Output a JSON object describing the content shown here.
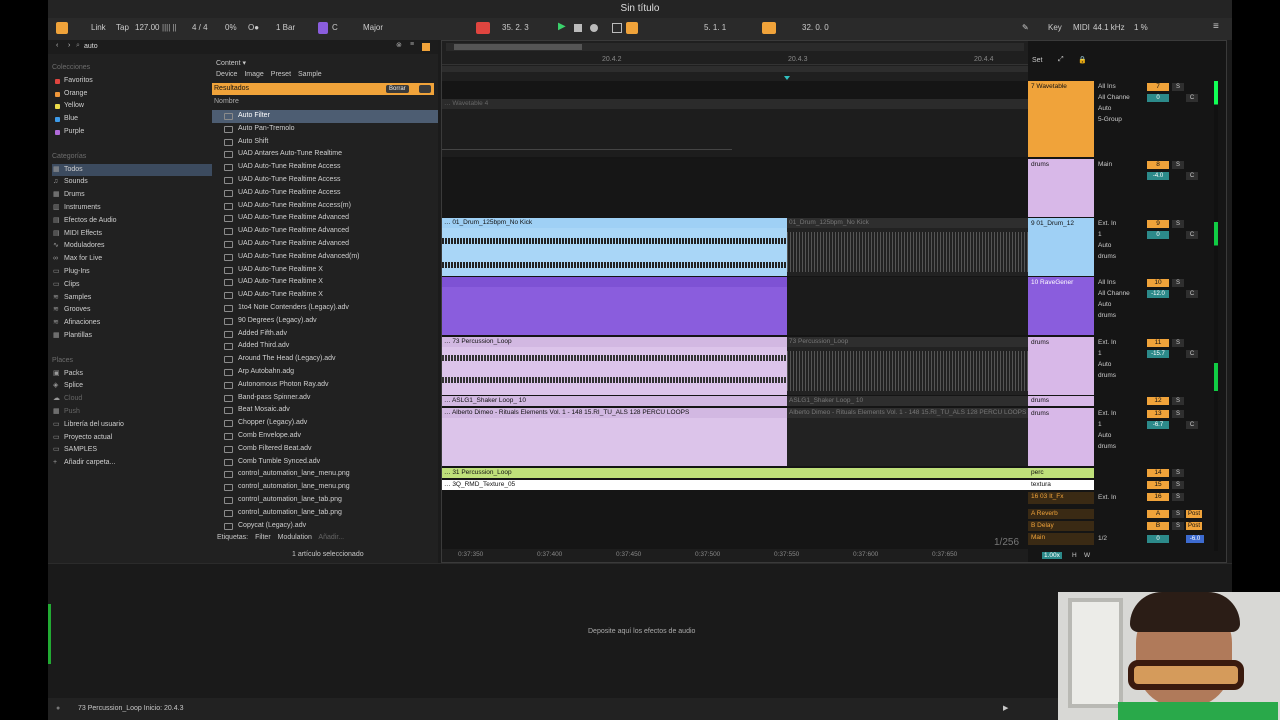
{
  "window": {
    "title": "Sin título"
  },
  "control": {
    "link": "Link",
    "tap": "Tap",
    "tempo": "127.00",
    "sig": "4 / 4",
    "swing": "0%",
    "quant": "1 Bar",
    "key": "C",
    "scale": "Major",
    "pos": "35.   2.   3",
    "loop_start": "5.   1.   1",
    "loop_len": "32.   0.   0",
    "key_btn": "Key",
    "midi_btn": "MIDI",
    "sample_rate": "44.1 kHz",
    "cpu": "1 %"
  },
  "browser": {
    "search": "auto",
    "collections_header": "Colecciones",
    "collections": [
      {
        "label": "Favoritos",
        "color": "#e0453f"
      },
      {
        "label": "Orange",
        "color": "#f0973a"
      },
      {
        "label": "Yellow",
        "color": "#eddc4a"
      },
      {
        "label": "Blue",
        "color": "#3d9be9"
      },
      {
        "label": "Purple",
        "color": "#b06ad9"
      }
    ],
    "categories_header": "Categorías",
    "categories": [
      "Todos",
      "Sounds",
      "Drums",
      "Instruments",
      "Efectos de Audio",
      "MIDI Effects",
      "Moduladores",
      "Max for Live",
      "Plug-Ins",
      "Clips",
      "Samples",
      "Grooves",
      "Afinaciones",
      "Plantillas"
    ],
    "places_header": "Places",
    "places": [
      "Packs",
      "Splice",
      "Cloud",
      "Push",
      "Librería del usuario",
      "Proyecto actual",
      "SAMPLES",
      "Añadir carpeta..."
    ],
    "content_label": "Content",
    "filters": [
      "Device",
      "Image",
      "Preset",
      "Sample"
    ],
    "results_label": "Resultados",
    "clear_label": "Borrar",
    "name_col": "Nombre",
    "files": [
      "Auto Filter",
      "Auto Pan-Tremolo",
      "Auto Shift",
      "UAD Antares Auto-Tune Realtime",
      "UAD Auto-Tune Realtime Access",
      "UAD Auto-Tune Realtime Access",
      "UAD Auto-Tune Realtime Access",
      "UAD Auto-Tune Realtime Access(m)",
      "UAD Auto-Tune Realtime Advanced",
      "UAD Auto-Tune Realtime Advanced",
      "UAD Auto-Tune Realtime Advanced",
      "UAD Auto-Tune Realtime Advanced(m)",
      "UAD Auto-Tune Realtime X",
      "UAD Auto-Tune Realtime X",
      "UAD Auto-Tune Realtime X",
      "1to4 Note Contenders (Legacy).adv",
      "90 Degrees (Legacy).adv",
      "Added Fifth.adv",
      "Added Third.adv",
      "Around The Head (Legacy).adv",
      "Arp Autobahn.adg",
      "Autonomous Photon Ray.adv",
      "Band-pass Spinner.adv",
      "Beat Mosaic.adv",
      "Chopper (Legacy).adv",
      "Comb Envelope.adv",
      "Comb Filtered Beat.adv",
      "Comb Tumble Synced.adv",
      "control_automation_lane_menu.png",
      "control_automation_lane_menu.png",
      "control_automation_lane_tab.png",
      "control_automation_lane_tab.png",
      "Copycat (Legacy).adv"
    ],
    "tags_label": "Etiquetas:",
    "tag_filter": "Filter",
    "tag_mod": "Modulation",
    "tag_add": "Añadir...",
    "selected_info": "1 artículo seleccionado"
  },
  "arrangement": {
    "ruler_marks": [
      "20.4.2",
      "20.4.3",
      "20.4.4"
    ],
    "time_marks": [
      "0:37:350",
      "0:37:400",
      "0:37:450",
      "0:37:500",
      "0:37:550",
      "0:37:600",
      "0:37:650"
    ],
    "zoom": "1/256",
    "clips": {
      "wavetable": "Wavetable 4",
      "drum_a": "01_Drum_125bpm_No Kick",
      "drum_b": "01_Drum_125bpm_No Kick",
      "perc_a": "73 Percussion_Loop",
      "perc_b": "73 Percussion_Loop",
      "shaker_a": "ASLG1_Shaker Loop_ 10",
      "shaker_b": "ASLG1_Shaker Loop_ 10",
      "alberto_a": "Alberto Dimeo - Rituals Elements Vol. 1 - 148 15.RI_TU_ALS 128 PERCU LOOPS",
      "alberto_b": "Alberto Dimeo - Rituals Elements Vol. 1 - 148 15.RI_TU_ALS 128 PERCU LOOPS",
      "perc31": "31 Percussion_Loop",
      "texture": "3Q_RMD_Texture_05"
    }
  },
  "mixer": {
    "set_label": "Set",
    "tracks": [
      {
        "name": "7 Wavetable",
        "color": "#f0a33a",
        "in": "All Ins",
        "ch": "All Channe",
        "mon": "Auto",
        "out": "5-Group",
        "num": "7",
        "vol": "0",
        "pan": "C"
      },
      {
        "name": "drums",
        "color": "#d8b8e8",
        "in": "Main",
        "ch": "",
        "mon": "",
        "out": "",
        "num": "8",
        "vol": "-4.0",
        "pan": "C"
      },
      {
        "name": "9 01_Drum_12",
        "color": "#9fd0f5",
        "in": "Ext. In",
        "ch": "1",
        "mon": "Auto",
        "out": "drums",
        "num": "9",
        "vol": "0",
        "pan": "C"
      },
      {
        "name": "10 RaveGener",
        "color": "#8a5ddd",
        "in": "All Ins",
        "ch": "All Channe",
        "mon": "Auto",
        "out": "drums",
        "num": "10",
        "vol": "-12.0",
        "pan": "C"
      },
      {
        "name": "drums",
        "color": "#d8b8e8",
        "in": "Ext. In",
        "ch": "1",
        "mon": "Auto",
        "out": "drums",
        "num": "11",
        "vol": "-15.7",
        "pan": "C"
      },
      {
        "name": "drums",
        "color": "#d8b8e8",
        "in": "",
        "ch": "",
        "mon": "",
        "out": "",
        "num": "12",
        "vol": "",
        "pan": ""
      },
      {
        "name": "drums",
        "color": "#d8b8e8",
        "in": "Ext. In",
        "ch": "1",
        "mon": "Auto",
        "out": "drums",
        "num": "13",
        "vol": "-6.7",
        "pan": "C"
      },
      {
        "name": "perc",
        "color": "#bfe07a",
        "num": "14"
      },
      {
        "name": "textura",
        "color": "#ffffff",
        "num": "15"
      },
      {
        "name": "16 03 It_Fx",
        "color": "#f0a33a",
        "in": "Ext. In",
        "num": "16"
      },
      {
        "name": "A Reverb",
        "color": "#f0a33a",
        "num": "A",
        "post": "Post"
      },
      {
        "name": "B Delay",
        "color": "#f0a33a",
        "num": "B",
        "post": "Post"
      },
      {
        "name": "Main",
        "color": "#f0a33a",
        "in": "1/2",
        "num": "0",
        "vol": "-6.0"
      }
    ],
    "snap": "1.00x",
    "h_btn": "H",
    "w_btn": "W"
  },
  "device": {
    "drop_text": "Deposite aquí los efectos de audio"
  },
  "status": {
    "text": "73 Percussion_Loop  Inicio: 20.4.3"
  },
  "colors": {
    "accent": "#f0a33a",
    "blue_clip": "#9fd0f5",
    "purple_clip": "#8a5ddd",
    "lilac_clip": "#d8b8e8",
    "green_clip": "#bfe07a"
  }
}
